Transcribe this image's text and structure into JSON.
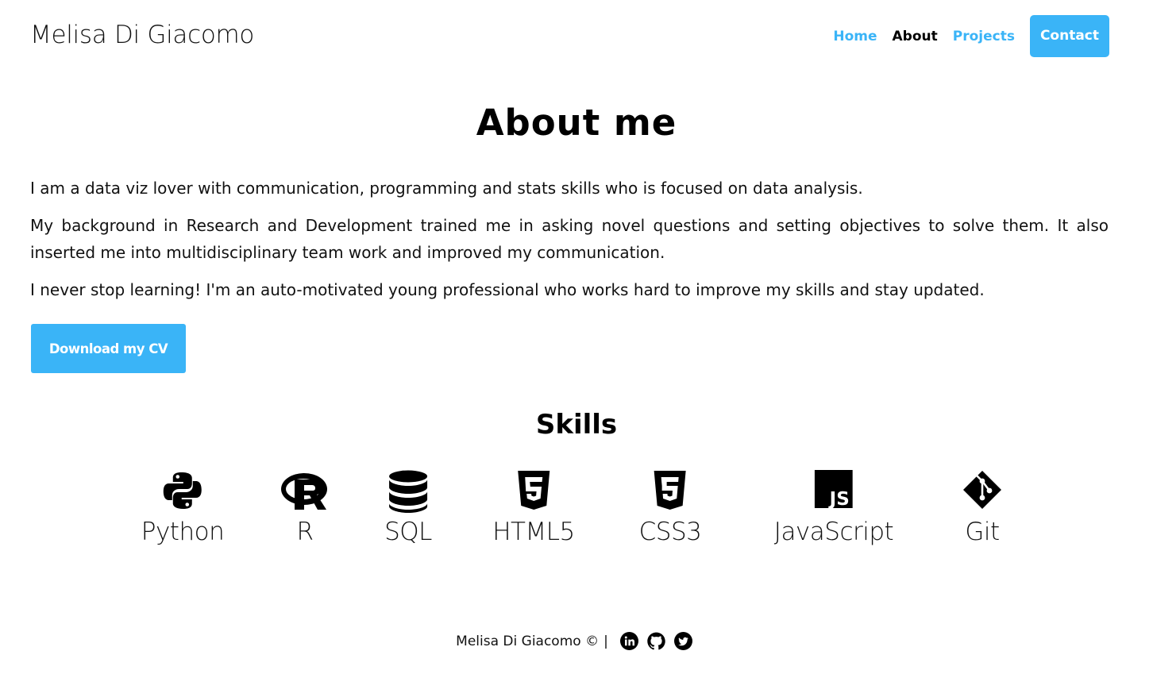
{
  "header": {
    "brand": "Melisa Di Giacomo",
    "nav": {
      "home": "Home",
      "about": "About",
      "projects": "Projects",
      "contact": "Contact"
    }
  },
  "main": {
    "title": "About me",
    "paragraphs": [
      "I am a data viz lover with communication, programming and stats skills who is focused on data analysis.",
      "My background in Research and Development trained me in asking novel questions and setting objectives to solve them. It also inserted me into multidisciplinary team work and improved my communication.",
      "I never stop learning! I'm an auto-motivated young professional who works hard to improve my skills and stay updated."
    ],
    "cv_button": "Download my CV"
  },
  "skills": {
    "title": "Skills",
    "items": [
      {
        "label": "Python",
        "icon": "python-icon"
      },
      {
        "label": "R",
        "icon": "r-icon"
      },
      {
        "label": "SQL",
        "icon": "database-icon"
      },
      {
        "label": "HTML5",
        "icon": "html5-icon"
      },
      {
        "label": "CSS3",
        "icon": "css3-icon"
      },
      {
        "label": "JavaScript",
        "icon": "javascript-icon"
      },
      {
        "label": "Git",
        "icon": "git-icon"
      }
    ]
  },
  "footer": {
    "text": "Melisa Di Giacomo ©",
    "separator": "|",
    "social": [
      "linkedin-icon",
      "github-icon",
      "twitter-icon"
    ]
  },
  "colors": {
    "accent": "#3ab4f7",
    "text": "#000000",
    "background": "#ffffff"
  }
}
